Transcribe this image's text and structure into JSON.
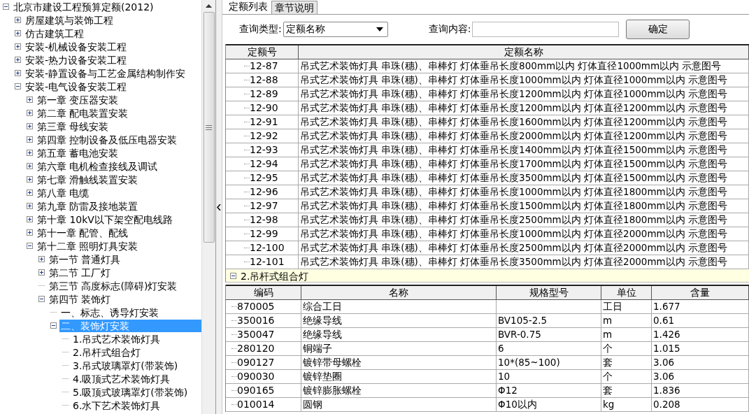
{
  "tree": {
    "label": "北京市建设工程预算定额(2012)",
    "expanded": true,
    "selected": false,
    "children": [
      {
        "label": "房屋建筑与装饰工程",
        "expanded": false,
        "selected": false
      },
      {
        "label": "仿古建筑工程",
        "expanded": false,
        "selected": false
      },
      {
        "label": "安装-机械设备安装工程",
        "expanded": false,
        "selected": false
      },
      {
        "label": "安装-热力设备安装工程",
        "expanded": false,
        "selected": false
      },
      {
        "label": "安装-静置设备与工艺金属结构制作安",
        "expanded": false,
        "selected": false
      },
      {
        "label": "安装-电气设备安装工程",
        "expanded": true,
        "selected": false,
        "children": [
          {
            "label": "第一章  变压器安装",
            "expanded": false,
            "selected": false
          },
          {
            "label": "第二章  配电装置安装",
            "expanded": false,
            "selected": false
          },
          {
            "label": "第三章  母线安装",
            "expanded": false,
            "selected": false
          },
          {
            "label": "第四章  控制设备及低压电器安装",
            "expanded": false,
            "selected": false
          },
          {
            "label": "第五章  蓄电池安装",
            "expanded": false,
            "selected": false
          },
          {
            "label": "第六章  电机检查接线及调试",
            "expanded": false,
            "selected": false
          },
          {
            "label": "第七章  滑触线装置安装",
            "expanded": false,
            "selected": false
          },
          {
            "label": "第八章  电缆",
            "expanded": false,
            "selected": false
          },
          {
            "label": "第九章  防雷及接地装置",
            "expanded": false,
            "selected": false
          },
          {
            "label": "第十章  10kV以下架空配电线路",
            "expanded": false,
            "selected": false
          },
          {
            "label": "第十一章  配管、配线",
            "expanded": false,
            "selected": false
          },
          {
            "label": "第十二章  照明灯具安装",
            "expanded": true,
            "selected": false,
            "children": [
              {
                "label": "第一节  普通灯具",
                "expanded": false,
                "selected": false
              },
              {
                "label": "第二节  工厂灯",
                "expanded": false,
                "selected": false
              },
              {
                "label": "第三节  高度标志(障碍)灯安装",
                "selected": false
              },
              {
                "label": "第四节  装饰灯",
                "expanded": true,
                "selected": false,
                "children": [
                  {
                    "label": "一、标志、诱导灯安装",
                    "selected": false
                  },
                  {
                    "label": "二、装饰灯安装",
                    "expanded": true,
                    "selected": true,
                    "children": [
                      {
                        "label": "1.吊式艺术装饰灯具",
                        "selected": false
                      },
                      {
                        "label": "2.吊杆式组合灯",
                        "selected": false
                      },
                      {
                        "label": "3.吊式玻璃罩灯(带装饰)",
                        "selected": false
                      },
                      {
                        "label": "4.吸顶式艺术装饰灯具",
                        "selected": false
                      },
                      {
                        "label": "5.吸顶式玻璃罩灯(带装饰)",
                        "selected": false
                      },
                      {
                        "label": "6.水下艺术装饰灯具",
                        "selected": false
                      }
                    ]
                  }
                ]
              }
            ]
          }
        ]
      }
    ]
  },
  "tabs": [
    {
      "label": "定额列表",
      "selected": true
    },
    {
      "label": "章节说明",
      "selected": false
    }
  ],
  "query": {
    "type_label": "查询类型:",
    "type_value": "定额名称",
    "content_label": "查询内容:",
    "button": "确定"
  },
  "quota_table": {
    "columns": [
      "定额号",
      "定额名称"
    ],
    "rows": [
      {
        "kind": "item",
        "code": "12-87",
        "name": "吊式艺术装饰灯具  串珠(穗)、串棒灯  灯体垂吊长度800mm以内  灯体直径1000mm以内  示意图号"
      },
      {
        "kind": "item",
        "code": "12-88",
        "name": "吊式艺术装饰灯具  串珠(穗)、串棒灯  灯体垂吊长度1000mm以内  灯体直径1000mm以内  示意图号"
      },
      {
        "kind": "item",
        "code": "12-89",
        "name": "吊式艺术装饰灯具  串珠(穗)、串棒灯  灯体垂吊长度1200mm以内  灯体直径1000mm以内  示意图号"
      },
      {
        "kind": "item",
        "code": "12-90",
        "name": "吊式艺术装饰灯具  串珠(穗)、串棒灯  灯体垂吊长度1200mm以内  灯体直径1200mm以内  示意图号"
      },
      {
        "kind": "item",
        "code": "12-91",
        "name": "吊式艺术装饰灯具  串珠(穗)、串棒灯  灯体垂吊长度1600mm以内  灯体直径1200mm以内  示意图号"
      },
      {
        "kind": "item",
        "code": "12-92",
        "name": "吊式艺术装饰灯具  串珠(穗)、串棒灯  灯体垂吊长度2000mm以内  灯体直径1200mm以内  示意图号"
      },
      {
        "kind": "item",
        "code": "12-93",
        "name": "吊式艺术装饰灯具  串珠(穗)、串棒灯  灯体垂吊长度1400mm以内  灯体直径1500mm以内  示意图号"
      },
      {
        "kind": "item",
        "code": "12-94",
        "name": "吊式艺术装饰灯具  串珠(穗)、串棒灯  灯体垂吊长度1700mm以内  灯体直径1500mm以内  示意图号"
      },
      {
        "kind": "item",
        "code": "12-95",
        "name": "吊式艺术装饰灯具  串珠(穗)、串棒灯  灯体垂吊长度3500mm以内  灯体直径1500mm以内  示意图号"
      },
      {
        "kind": "item",
        "code": "12-96",
        "name": "吊式艺术装饰灯具  串珠(穗)、串棒灯  灯体垂吊长度1000mm以内  灯体直径1800mm以内  示意图号"
      },
      {
        "kind": "item",
        "code": "12-97",
        "name": "吊式艺术装饰灯具  串珠(穗)、串棒灯  灯体垂吊长度1500mm以内  灯体直径1800mm以内  示意图号"
      },
      {
        "kind": "item",
        "code": "12-98",
        "name": "吊式艺术装饰灯具  串珠(穗)、串棒灯  灯体垂吊长度2500mm以内  灯体直径1800mm以内  示意图号"
      },
      {
        "kind": "item",
        "code": "12-99",
        "name": "吊式艺术装饰灯具  串珠(穗)、串棒灯  灯体垂吊长度1000mm以内  灯体直径2000mm以内  示意图号"
      },
      {
        "kind": "item",
        "code": "12-100",
        "name": "吊式艺术装饰灯具  串珠(穗)、串棒灯  灯体垂吊长度2500mm以内  灯体直径2000mm以内  示意图号"
      },
      {
        "kind": "item",
        "code": "12-101",
        "name": "吊式艺术装饰灯具  串珠(穗)、串棒灯  灯体垂吊长度3500mm以内  灯体直径2000mm以内  示意图号"
      },
      {
        "kind": "group",
        "name": "2.吊杆式组合灯",
        "expanded": true
      }
    ]
  },
  "material_table": {
    "columns": [
      "编码",
      "名称",
      "规格型号",
      "单位",
      "含量"
    ],
    "rows": [
      [
        "870005",
        "综合工日",
        "",
        "工日",
        "1.677"
      ],
      [
        "350016",
        "绝缘导线",
        "BV105-2.5",
        "m",
        "0.61"
      ],
      [
        "350047",
        "绝缘导线",
        "BVR-0.75",
        "m",
        "1.426"
      ],
      [
        "280120",
        "铜端子",
        "6",
        "个",
        "1.015"
      ],
      [
        "090127",
        "镀锌带母螺栓",
        "10*(85~100)",
        "套",
        "3.06"
      ],
      [
        "090030",
        "镀锌垫圈",
        "10",
        "个",
        "3.06"
      ],
      [
        "090165",
        "镀锌膨胀螺栓",
        "Φ12",
        "套",
        "1.836"
      ],
      [
        "010014",
        "圆钢",
        "Φ10以内",
        "kg",
        "0.208"
      ]
    ]
  }
}
